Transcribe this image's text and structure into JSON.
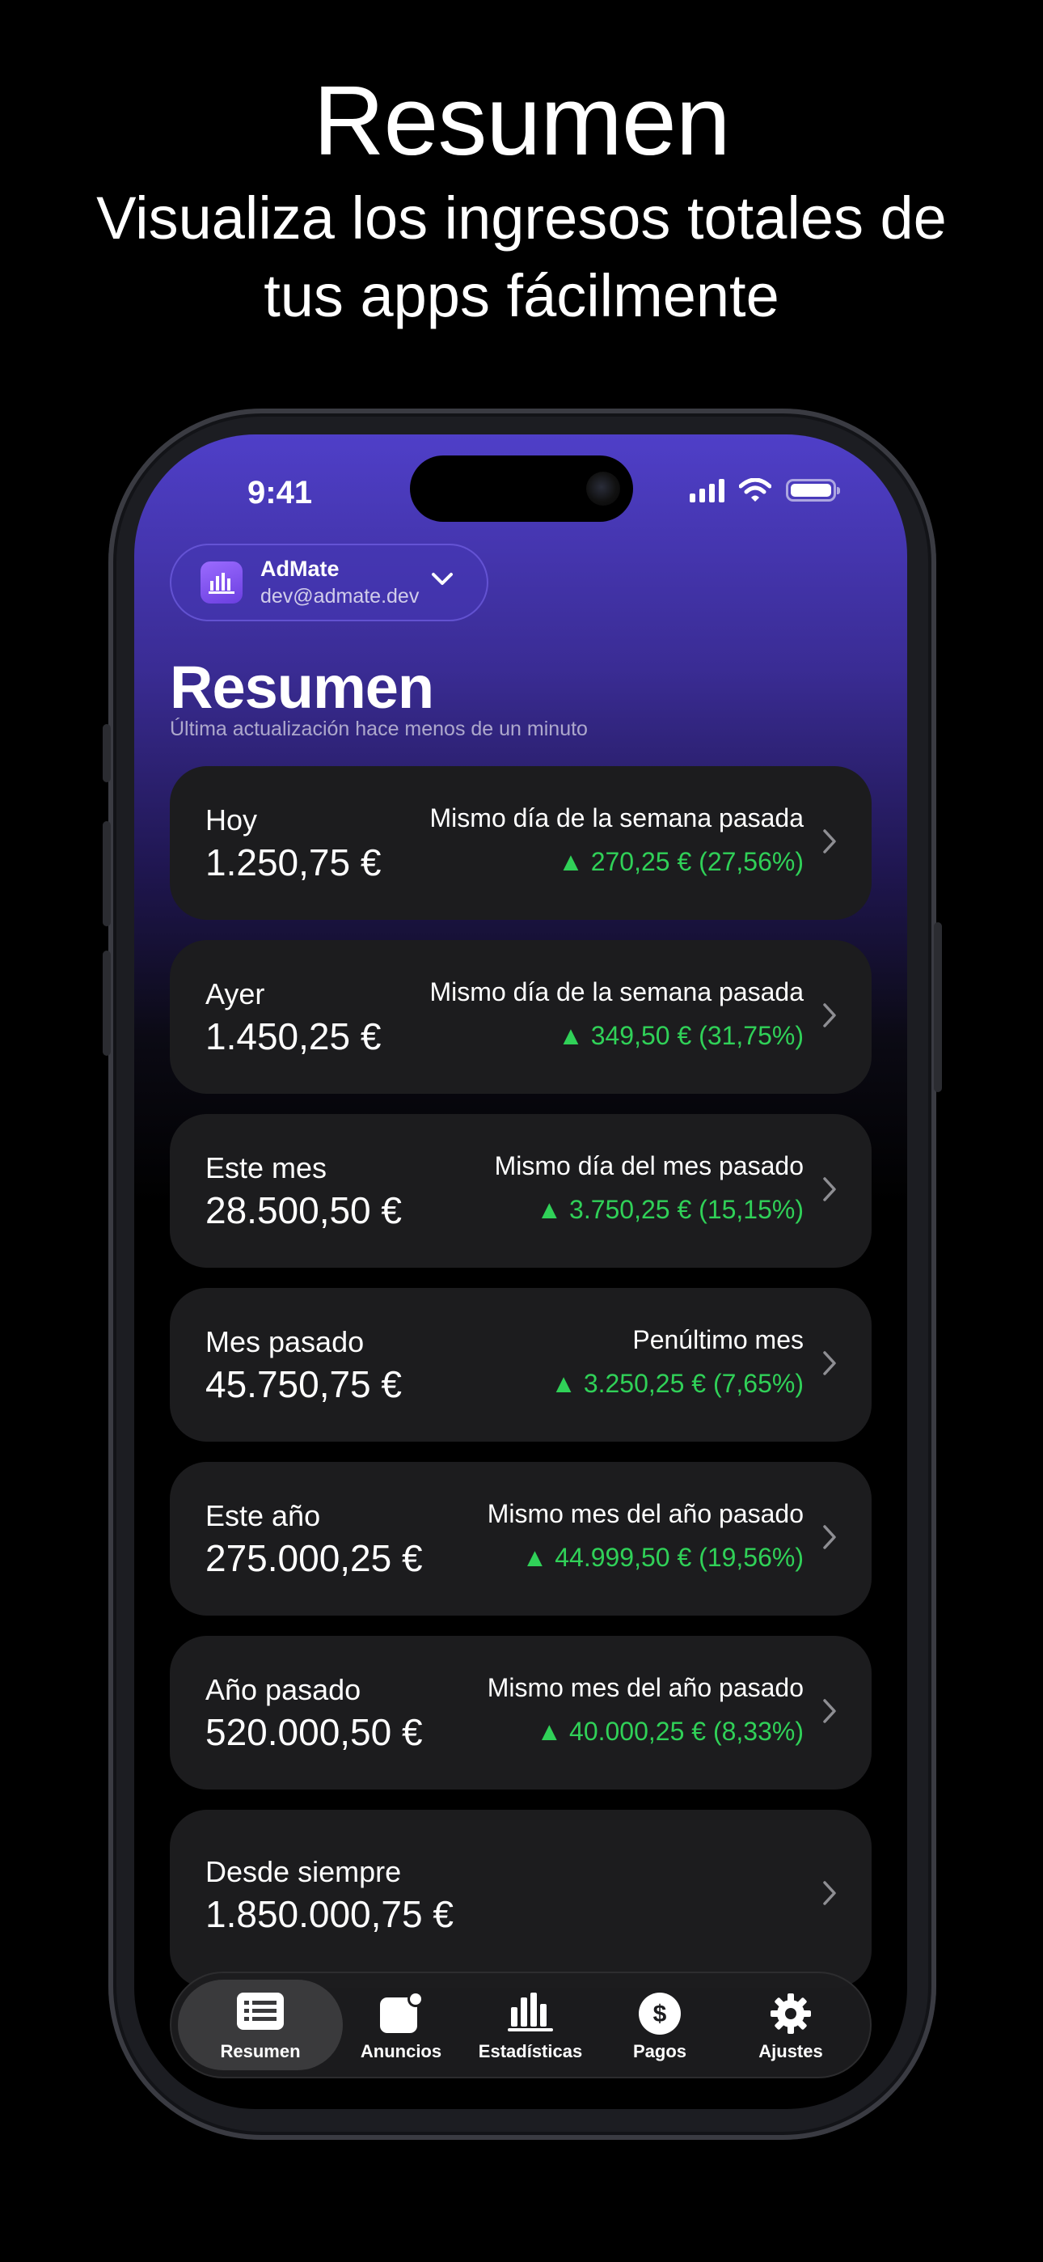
{
  "hero": {
    "title": "Resumen",
    "subtitle_line1": "Visualiza los ingresos totales de",
    "subtitle_line2": "tus apps fácilmente"
  },
  "status_bar": {
    "time": "9:41"
  },
  "account": {
    "name": "AdMate",
    "email": "dev@admate.dev",
    "icon": "bar-chart-icon"
  },
  "page": {
    "title": "Resumen",
    "subtitle": "Última actualización hace menos de un minuto"
  },
  "cards": [
    {
      "label": "Hoy",
      "amount": "1.250,75 €",
      "comparison": "Mismo día de la semana pasada",
      "delta": "▲ 270,25 € (27,56%)"
    },
    {
      "label": "Ayer",
      "amount": "1.450,25 €",
      "comparison": "Mismo día de la semana pasada",
      "delta": "▲ 349,50 € (31,75%)"
    },
    {
      "label": "Este mes",
      "amount": "28.500,50 €",
      "comparison": "Mismo día del mes pasado",
      "delta": "▲ 3.750,25 € (15,15%)"
    },
    {
      "label": "Mes pasado",
      "amount": "45.750,75 €",
      "comparison": "Penúltimo mes",
      "delta": "▲ 3.250,25 € (7,65%)"
    },
    {
      "label": "Este año",
      "amount": "275.000,25 €",
      "comparison": "Mismo mes del año pasado",
      "delta": "▲ 44.999,50 € (19,56%)"
    },
    {
      "label": "Año pasado",
      "amount": "520.000,50 €",
      "comparison": "Mismo mes del año pasado",
      "delta": "▲ 40.000,25 € (8,33%)"
    },
    {
      "label": "Desde siempre",
      "amount": "1.850.000,75 €"
    }
  ],
  "tabbar": {
    "tabs": [
      {
        "label": "Resumen",
        "icon": "list-icon",
        "active": true
      },
      {
        "label": "Anuncios",
        "icon": "ad-icon",
        "active": false
      },
      {
        "label": "Estadísticas",
        "icon": "stats-icon",
        "active": false
      },
      {
        "label": "Pagos",
        "icon": "dollar-icon",
        "active": false
      },
      {
        "label": "Ajustes",
        "icon": "gear-icon",
        "active": false
      }
    ]
  },
  "colors": {
    "positive": "#30d158",
    "accent": "#4f3fc8",
    "card": "#1c1c1e"
  }
}
